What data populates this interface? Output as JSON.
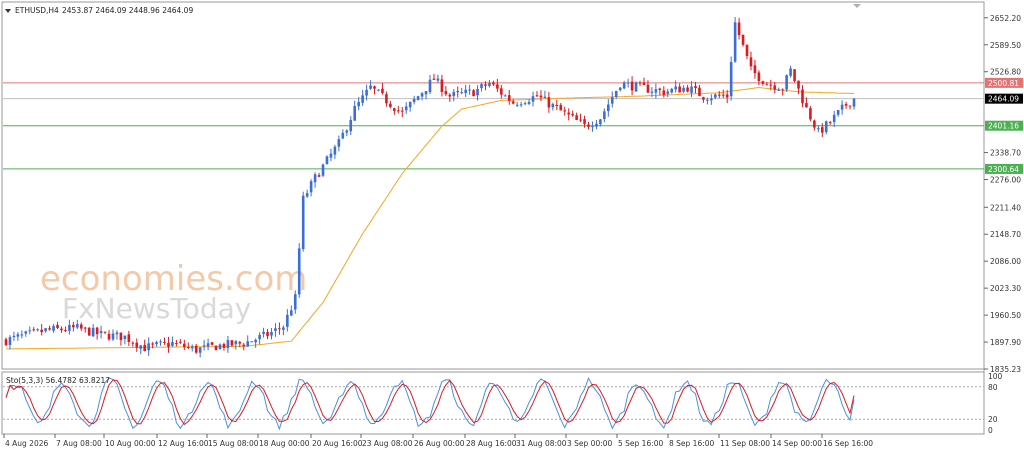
{
  "header": {
    "symbol_label": "ETHUSD,H4",
    "ohlc_label": "2453.87 2464.09 2448.96 2464.09"
  },
  "watermark": {
    "line1": "economies.com",
    "line2": "FxNewsToday"
  },
  "chart_data": {
    "type": "candlestick",
    "symbol": "ETHUSD",
    "timeframe": "H4",
    "ylim": [
      1835.23,
      2675
    ],
    "y_ticks": [
      "2652.20",
      "2589.50",
      "2526.80",
      "2464.09",
      "2401.16",
      "2338.70",
      "2276.00",
      "2211.40",
      "2148.70",
      "2086.00",
      "2023.30",
      "1960.50",
      "1897.90",
      "1835.23"
    ],
    "x_ticks": [
      "4 Aug 2026",
      "7 Aug 08:00",
      "10 Aug 00:00",
      "12 Aug 16:00",
      "15 Aug 08:00",
      "18 Aug 00:00",
      "20 Aug 16:00",
      "23 Aug 08:00",
      "26 Aug 00:00",
      "28 Aug 16:00",
      "31 Aug 08:00",
      "3 Sep 00:00",
      "5 Sep 16:00",
      "8 Sep 16:00",
      "11 Sep 08:00",
      "14 Sep 00:00",
      "16 Sep 16:00"
    ],
    "horizontal_levels": [
      {
        "value": 2500.81,
        "label": "2500.81",
        "color": "#e57373"
      },
      {
        "value": 2464.09,
        "label": "2464.09",
        "color": "#000000"
      },
      {
        "value": 2401.16,
        "label": "2401.16",
        "color": "#4caf50"
      },
      {
        "value": 2300.64,
        "label": "2300.64",
        "color": "#4caf50"
      }
    ],
    "moving_average_color": "#f5a623",
    "bull_color": "#3b6fd6",
    "bear_color": "#e0191e",
    "price_path": [
      [
        0,
        1902
      ],
      [
        10,
        1925
      ],
      [
        18,
        1930
      ],
      [
        24,
        1915
      ],
      [
        30,
        1910
      ],
      [
        35,
        1885
      ],
      [
        42,
        1895
      ],
      [
        48,
        1880
      ],
      [
        54,
        1890
      ],
      [
        60,
        1895
      ],
      [
        66,
        1915
      ],
      [
        70,
        1935
      ],
      [
        73,
        2000
      ],
      [
        75,
        2230
      ],
      [
        78,
        2280
      ],
      [
        84,
        2360
      ],
      [
        88,
        2440
      ],
      [
        92,
        2490
      ],
      [
        96,
        2460
      ],
      [
        100,
        2430
      ],
      [
        104,
        2470
      ],
      [
        108,
        2510
      ],
      [
        112,
        2470
      ],
      [
        118,
        2480
      ],
      [
        122,
        2500
      ],
      [
        128,
        2455
      ],
      [
        134,
        2470
      ],
      [
        140,
        2435
      ],
      [
        146,
        2400
      ],
      [
        150,
        2420
      ],
      [
        155,
        2500
      ],
      [
        160,
        2490
      ],
      [
        166,
        2480
      ],
      [
        172,
        2490
      ],
      [
        176,
        2470
      ],
      [
        182,
        2470
      ],
      [
        184,
        2640
      ],
      [
        188,
        2530
      ],
      [
        192,
        2500
      ],
      [
        196,
        2490
      ],
      [
        198,
        2530
      ],
      [
        202,
        2440
      ],
      [
        205,
        2385
      ],
      [
        208,
        2410
      ],
      [
        212,
        2450
      ],
      [
        214,
        2464
      ]
    ],
    "ma_path": [
      [
        0,
        1882
      ],
      [
        30,
        1885
      ],
      [
        60,
        1888
      ],
      [
        72,
        1900
      ],
      [
        80,
        1990
      ],
      [
        90,
        2150
      ],
      [
        100,
        2290
      ],
      [
        110,
        2400
      ],
      [
        115,
        2440
      ],
      [
        125,
        2460
      ],
      [
        140,
        2465
      ],
      [
        160,
        2470
      ],
      [
        180,
        2478
      ],
      [
        190,
        2490
      ],
      [
        200,
        2480
      ],
      [
        214,
        2476
      ]
    ],
    "oscillator": {
      "label": "Sto(5,3,3) 56.4782 63.8217",
      "k_value": 56.4782,
      "d_value": 63.8217,
      "ylim": [
        0,
        100
      ],
      "levels": [
        80,
        20
      ],
      "y_tick_labels": [
        "100",
        "80",
        "20",
        "0"
      ],
      "k_color": "#4a90e2",
      "d_color": "#e0191e"
    }
  }
}
